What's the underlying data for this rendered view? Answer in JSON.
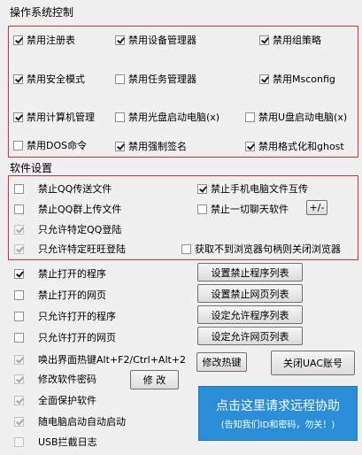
{
  "os_section": {
    "title": "操作系统控制",
    "items": [
      {
        "label": "禁用注册表",
        "checked": true
      },
      {
        "label": "禁用设备管理器",
        "checked": true
      },
      {
        "label": "禁用组策略",
        "checked": true
      },
      {
        "label": "禁用安全模式",
        "checked": true
      },
      {
        "label": "禁用任务管理器",
        "checked": false
      },
      {
        "label": "禁用Msconfig",
        "checked": true
      },
      {
        "label": "禁用计算机管理",
        "checked": true
      },
      {
        "label": "禁用光盘启动电脑(x)",
        "checked": false
      },
      {
        "label": "禁用U盘启动电脑(x)",
        "checked": false
      },
      {
        "label": "禁用DOS命令",
        "checked": false
      },
      {
        "label": "禁用强制签名",
        "checked": true
      },
      {
        "label": "禁用格式化和ghost",
        "checked": true
      }
    ]
  },
  "sw_section": {
    "title": "软件设置",
    "items": [
      {
        "label": "禁止QQ传送文件",
        "checked": false
      },
      {
        "label": "禁止手机电脑文件互传",
        "checked": true
      },
      {
        "label": "禁止QQ群上传文件",
        "checked": false
      },
      {
        "label": "禁止一切聊天软件",
        "checked": false
      },
      {
        "label": "只允许特定QQ登陆",
        "checked": true
      },
      {
        "label": "只允许特定旺旺登陆",
        "checked": true
      },
      {
        "label": "获取不到浏览器句柄则关闭浏览器",
        "checked": false
      }
    ],
    "plus_minus_label": "+/-"
  },
  "program_rows": [
    {
      "label": "禁止打开的程序",
      "checked": true,
      "button": "设置禁止程序列表"
    },
    {
      "label": "禁止打开的网页",
      "checked": false,
      "button": "设置禁止网页列表"
    },
    {
      "label": "只允许打开的程序",
      "checked": false,
      "button": "设定允许程序列表"
    },
    {
      "label": "只允许打开的网页",
      "checked": false,
      "button": "设定允许网页列表"
    }
  ],
  "bottom": {
    "hotkey_label": "唤出界面热键Alt+F2/Ctrl+Alt+2",
    "hotkey_checked": true,
    "modify_hotkey_button": "修改热键",
    "close_uac_button": "关闭UAC账号",
    "password_label": "修改软件密码",
    "password_checked": true,
    "modify_button": "修 改",
    "protect_label": "全面保护软件",
    "protect_checked": true,
    "autostart_label": "随电脑启动自动启动",
    "autostart_checked": true,
    "usb_label": "USB拦截日志",
    "usb_checked": false
  },
  "promo": {
    "line1": "点击这里请求远程协助",
    "line2": "(告知我们ID和密码，勿关！)",
    "color": "#2b8ed8"
  }
}
